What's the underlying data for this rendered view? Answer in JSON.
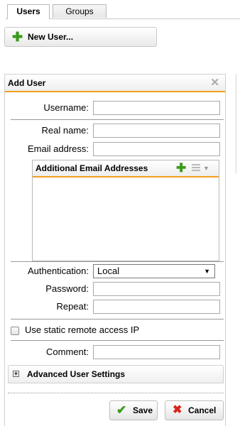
{
  "tabs": [
    {
      "label": "Users",
      "active": true
    },
    {
      "label": "Groups",
      "active": false
    }
  ],
  "toolbar": {
    "new_user_label": "New User...",
    "icon": "plus-icon"
  },
  "dialog": {
    "title": "Add User",
    "fields": {
      "username": {
        "label": "Username:",
        "value": ""
      },
      "real_name": {
        "label": "Real name:",
        "value": ""
      },
      "email": {
        "label": "Email address:",
        "value": ""
      },
      "authentication": {
        "label": "Authentication:",
        "value": "Local"
      },
      "password": {
        "label": "Password:",
        "value": ""
      },
      "repeat": {
        "label": "Repeat:",
        "value": ""
      },
      "comment": {
        "label": "Comment:",
        "value": ""
      }
    },
    "additional_emails": {
      "title": "Additional Email Addresses",
      "items": []
    },
    "static_ip": {
      "label": "Use static remote access IP",
      "checked": false
    },
    "advanced": {
      "label": "Advanced User Settings",
      "expanded": false
    },
    "buttons": {
      "save": "Save",
      "cancel": "Cancel"
    }
  },
  "colors": {
    "accent": "#f0a01e",
    "add_green": "#3a9a1d",
    "cancel_red": "#d9261c"
  }
}
